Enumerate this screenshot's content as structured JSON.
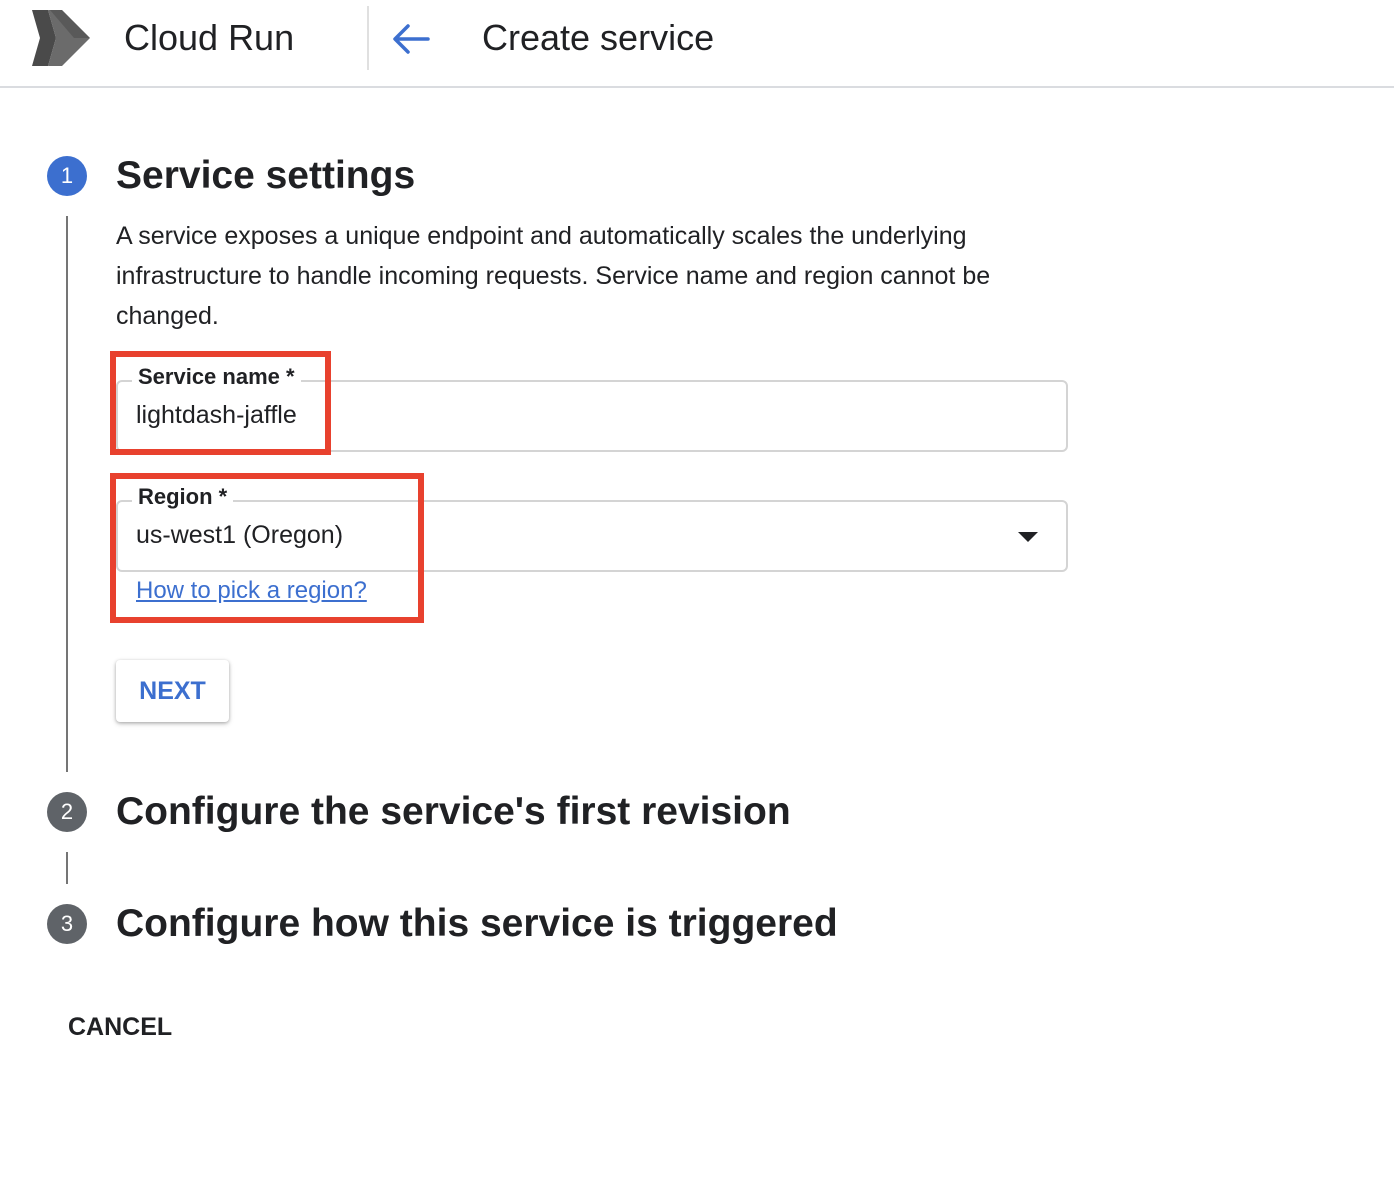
{
  "header": {
    "product_name": "Cloud Run",
    "page_title": "Create service",
    "back_icon": "arrow-left-icon",
    "logo_icon": "cloud-run-logo"
  },
  "steps": [
    {
      "number": "1",
      "title": "Service settings",
      "state": "active"
    },
    {
      "number": "2",
      "title": "Configure the service's first revision",
      "state": "inactive"
    },
    {
      "number": "3",
      "title": "Configure how this service is triggered",
      "state": "inactive"
    }
  ],
  "service_settings": {
    "description": "A service exposes a unique endpoint and automatically scales the underlying infrastructure to handle incoming requests. Service name and region cannot be changed.",
    "service_name": {
      "label": "Service name *",
      "value": "lightdash-jaffle"
    },
    "region": {
      "label": "Region *",
      "value": "us-west1 (Oregon)",
      "dropdown_icon": "caret-down-icon"
    },
    "help_link": "How to pick a region?",
    "next_label": "NEXT"
  },
  "footer": {
    "cancel_label": "CANCEL"
  },
  "colors": {
    "accent": "#3c6fcf",
    "highlight": "#e8412e",
    "inactive_step": "#5f6368",
    "text": "#202124"
  }
}
